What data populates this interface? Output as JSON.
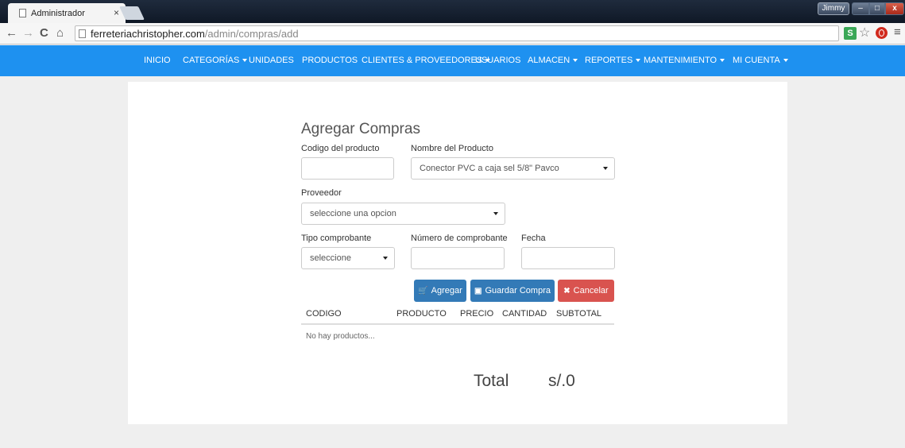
{
  "browser": {
    "tab_title": "Administrador",
    "tab_close": "×",
    "user_name": "Jimmy",
    "url_host": "ferreteriachristopher.com",
    "url_path": "/admin/compras/add",
    "ext_s": "S"
  },
  "navbar": {
    "items": [
      {
        "label": "INICIO"
      },
      {
        "label": "CATEGORÍAS"
      },
      {
        "label": "UNIDADES"
      },
      {
        "label": "PRODUCTOS"
      },
      {
        "label": "CLIENTES & PROVEEDORES"
      },
      {
        "label": "USUARIOS"
      },
      {
        "label": "ALMACEN"
      },
      {
        "label": "REPORTES"
      },
      {
        "label": "MANTENIMIENTO"
      },
      {
        "label": "MI CUENTA"
      }
    ]
  },
  "form": {
    "title": "Agregar Compras",
    "codigo_label": "Codigo del producto",
    "codigo_value": "",
    "nombre_label": "Nombre del Producto",
    "nombre_value": "Conector PVC a caja sel 5/8\" Pavco",
    "proveedor_label": "Proveedor",
    "proveedor_value": "seleccione una opcion",
    "tipo_label": "Tipo comprobante",
    "tipo_value": "seleccione",
    "numero_label": "Número de comprobante",
    "numero_value": "",
    "fecha_label": "Fecha",
    "fecha_value": ""
  },
  "buttons": {
    "agregar": "Agregar",
    "guardar": "Guardar Compra",
    "cancelar": "Cancelar"
  },
  "table": {
    "headers": [
      "CODIGO",
      "PRODUCTO",
      "PRECIO",
      "CANTIDAD",
      "SUBTOTAL"
    ],
    "empty_text": "No hay productos..."
  },
  "total": {
    "label": "Total",
    "value": "s/.0"
  },
  "colors": {
    "navbar": "#1e91f0",
    "primary": "#337ab7",
    "danger": "#d9534f"
  }
}
